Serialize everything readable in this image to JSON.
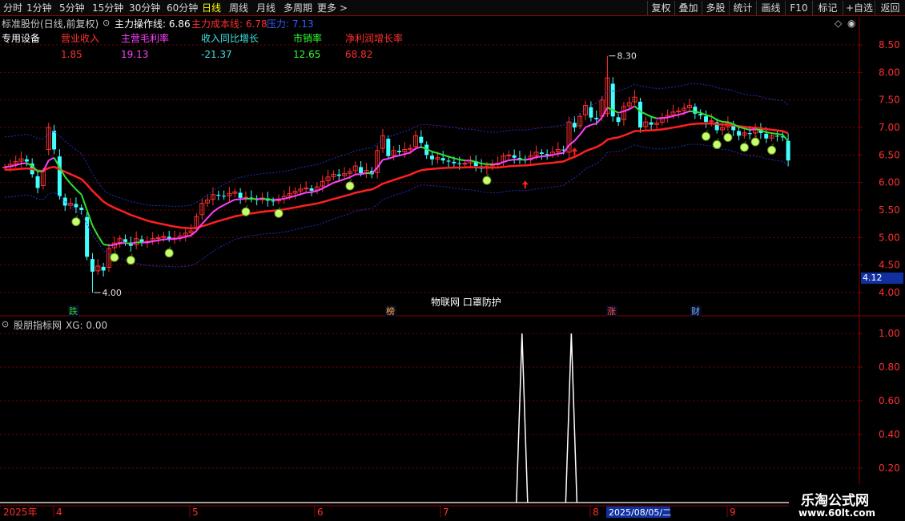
{
  "toolbar": {
    "left": [
      "分时",
      "1分钟",
      "5分钟",
      "15分钟",
      "30分钟",
      "60分钟",
      "日线",
      "周线",
      "月线",
      "多周期",
      "更多 >"
    ],
    "active_index": 6,
    "right": [
      "复权",
      "叠加",
      "多股",
      "统计",
      "画线",
      "F10",
      "标记",
      "+自选",
      "返回"
    ]
  },
  "info": {
    "stock_label": "标准股份(日线,前复权)",
    "indicator_name": "主力操作线: 6.86",
    "cost_line": "主力成本线: 6.78",
    "pressure": "压力: 7.13"
  },
  "fundamentals": {
    "category": "专用设备",
    "items": [
      {
        "label": "营业收入",
        "value": "1.85",
        "label_color": "#ff3030",
        "value_color": "#ff3030"
      },
      {
        "label": "主营毛利率",
        "value": "19.13",
        "label_color": "#ff40ff",
        "value_color": "#ff40ff"
      },
      {
        "label": "收入同比增长",
        "value": "-21.37",
        "label_color": "#40e0e0",
        "value_color": "#40e0e0"
      },
      {
        "label": "市销率",
        "value": "12.65",
        "label_color": "#30ff30",
        "value_color": "#30ff30"
      },
      {
        "label": "净利润增长率",
        "value": "68.82",
        "label_color": "#ff3030",
        "value_color": "#ff3030"
      }
    ]
  },
  "price_axis": [
    "8.50",
    "8.00",
    "7.50",
    "7.00",
    "6.50",
    "6.00",
    "5.50",
    "5.00",
    "4.50",
    "4.00"
  ],
  "current_price": "4.12",
  "annotations": {
    "high": "8.30",
    "low": "4.00",
    "concept": "物联网 口罩防护"
  },
  "event_tags": [
    {
      "text": "跌",
      "color": "#30d030"
    },
    {
      "text": "榜",
      "color": "#ffb040"
    },
    {
      "text": "涨",
      "color": "#ff5050"
    },
    {
      "text": "财",
      "color": "#6fb6ff"
    }
  ],
  "sub_panel": {
    "title": "股朋指标网",
    "xg_label": "XG: 0.00",
    "axis": [
      "1.00",
      "0.80",
      "0.60",
      "0.40",
      "0.20"
    ]
  },
  "date_axis": {
    "year": "2025年",
    "months": [
      "4",
      "5",
      "6",
      "7",
      "8",
      "9"
    ],
    "cursor_date": "2025/08/05/二"
  },
  "watermark": {
    "title": "乐淘公式网",
    "url": "www.60lt.com"
  },
  "colors": {
    "up": "#ff3030",
    "down": "#40ffff",
    "cost_line": "#ff2020",
    "operate_line_up": "#ff40ff",
    "operate_line_down": "#30e030",
    "band": "#2030c0",
    "grid": "#7a0000",
    "border": "#8b0000"
  },
  "chart_data": [
    {
      "type": "candlestick",
      "title": "标准股份(日线,前复权)",
      "x": [
        "2025-03-13",
        "2025-03-14",
        "2025-03-17",
        "2025-03-18",
        "2025-03-19",
        "2025-03-20",
        "2025-03-21",
        "2025-03-24",
        "2025-03-25",
        "2025-03-26",
        "2025-03-27",
        "2025-03-28",
        "2025-03-31",
        "2025-04-01",
        "2025-04-02",
        "2025-04-03",
        "2025-04-07",
        "2025-04-08",
        "2025-04-09",
        "2025-04-10",
        "2025-04-11",
        "2025-04-14",
        "2025-04-15",
        "2025-04-16",
        "2025-04-17",
        "2025-04-18",
        "2025-04-21",
        "2025-04-22",
        "2025-04-23",
        "2025-04-24",
        "2025-04-25",
        "2025-04-28",
        "2025-04-29",
        "2025-04-30",
        "2025-05-06",
        "2025-05-07",
        "2025-05-08",
        "2025-05-09",
        "2025-05-12",
        "2025-05-13",
        "2025-05-14",
        "2025-05-15",
        "2025-05-16",
        "2025-05-19",
        "2025-05-20",
        "2025-05-21",
        "2025-05-22",
        "2025-05-23",
        "2025-05-26",
        "2025-05-27",
        "2025-05-28",
        "2025-05-29",
        "2025-05-30",
        "2025-06-03",
        "2025-06-04",
        "2025-06-05",
        "2025-06-06",
        "2025-06-09",
        "2025-06-10",
        "2025-06-11",
        "2025-06-12",
        "2025-06-13",
        "2025-06-16",
        "2025-06-17",
        "2025-06-18",
        "2025-06-19",
        "2025-06-20",
        "2025-06-23",
        "2025-06-24",
        "2025-06-25",
        "2025-06-26",
        "2025-06-27",
        "2025-06-30",
        "2025-07-01",
        "2025-07-02",
        "2025-07-03",
        "2025-07-04",
        "2025-07-07",
        "2025-07-08",
        "2025-07-09",
        "2025-07-10",
        "2025-07-11",
        "2025-07-14",
        "2025-07-15",
        "2025-07-16",
        "2025-07-17",
        "2025-07-18",
        "2025-07-21",
        "2025-07-22",
        "2025-07-23",
        "2025-07-24",
        "2025-07-25",
        "2025-07-28",
        "2025-07-29",
        "2025-07-30",
        "2025-07-31",
        "2025-08-01",
        "2025-08-04",
        "2025-08-05",
        "2025-08-06",
        "2025-08-07",
        "2025-08-08",
        "2025-08-11",
        "2025-08-12",
        "2025-08-13",
        "2025-08-14",
        "2025-08-15",
        "2025-08-18",
        "2025-08-19",
        "2025-08-20",
        "2025-08-21",
        "2025-08-22",
        "2025-08-25",
        "2025-08-26",
        "2025-08-27",
        "2025-08-28",
        "2025-08-29",
        "2025-09-01",
        "2025-09-02",
        "2025-09-03",
        "2025-09-04",
        "2025-09-05",
        "2025-09-08",
        "2025-09-09",
        "2025-09-10",
        "2025-09-11",
        "2025-09-12",
        "2025-09-15",
        "2025-09-16",
        "2025-09-17",
        "2025-09-18",
        "2025-09-19",
        "2025-09-22",
        "2025-09-23",
        "2025-09-24",
        "2025-09-25",
        "2025-09-26",
        "2025-09-29",
        "2025-09-30",
        "2025-10-09"
      ],
      "close": [
        6.28,
        6.33,
        6.38,
        6.43,
        6.38,
        6.15,
        5.9,
        6.2,
        7.0,
        6.6,
        5.75,
        5.58,
        5.62,
        5.55,
        5.5,
        4.65,
        4.38,
        4.48,
        4.4,
        4.8,
        4.9,
        4.98,
        4.92,
        4.85,
        4.98,
        4.9,
        4.93,
        4.98,
        5.0,
        5.02,
        4.98,
        4.99,
        5.03,
        5.08,
        5.12,
        5.38,
        5.62,
        5.68,
        5.78,
        5.76,
        5.75,
        5.8,
        5.83,
        5.72,
        5.73,
        5.7,
        5.68,
        5.72,
        5.67,
        5.66,
        5.7,
        5.75,
        5.8,
        5.84,
        5.88,
        5.9,
        5.85,
        5.92,
        6.02,
        6.1,
        6.15,
        6.12,
        6.16,
        6.2,
        6.3,
        6.17,
        6.22,
        6.15,
        6.58,
        6.85,
        6.48,
        6.58,
        6.55,
        6.6,
        6.62,
        6.85,
        6.72,
        6.5,
        6.42,
        6.45,
        6.4,
        6.38,
        6.35,
        6.34,
        6.35,
        6.4,
        6.3,
        6.25,
        6.3,
        6.32,
        6.35,
        6.48,
        6.5,
        6.45,
        6.42,
        6.4,
        6.48,
        6.55,
        6.52,
        6.5,
        6.55,
        6.6,
        6.58,
        7.1,
        7.0,
        7.2,
        7.4,
        7.18,
        7.15,
        7.5,
        7.9,
        7.2,
        7.1,
        7.38,
        7.45,
        7.55,
        7.0,
        7.1,
        7.05,
        7.08,
        7.18,
        7.22,
        7.28,
        7.3,
        7.35,
        7.4,
        7.25,
        7.22,
        7.1,
        7.12,
        6.95,
        7.0,
        7.08,
        6.95,
        6.85,
        6.9,
        6.88,
        7.0,
        6.9,
        6.8,
        6.85,
        6.84,
        6.82,
        6.4
      ],
      "ylim": [
        3.75,
        8.85
      ],
      "high_label": 8.3,
      "low_label": 4.0
    },
    {
      "type": "line",
      "title": "股朋指标网",
      "series": [
        {
          "name": "XG",
          "peaks_at": [
            "2025-07-22",
            "2025-08-05"
          ],
          "values_note": "0 except 1.0 on signal days"
        }
      ],
      "ylim": [
        0,
        1.08
      ]
    }
  ]
}
